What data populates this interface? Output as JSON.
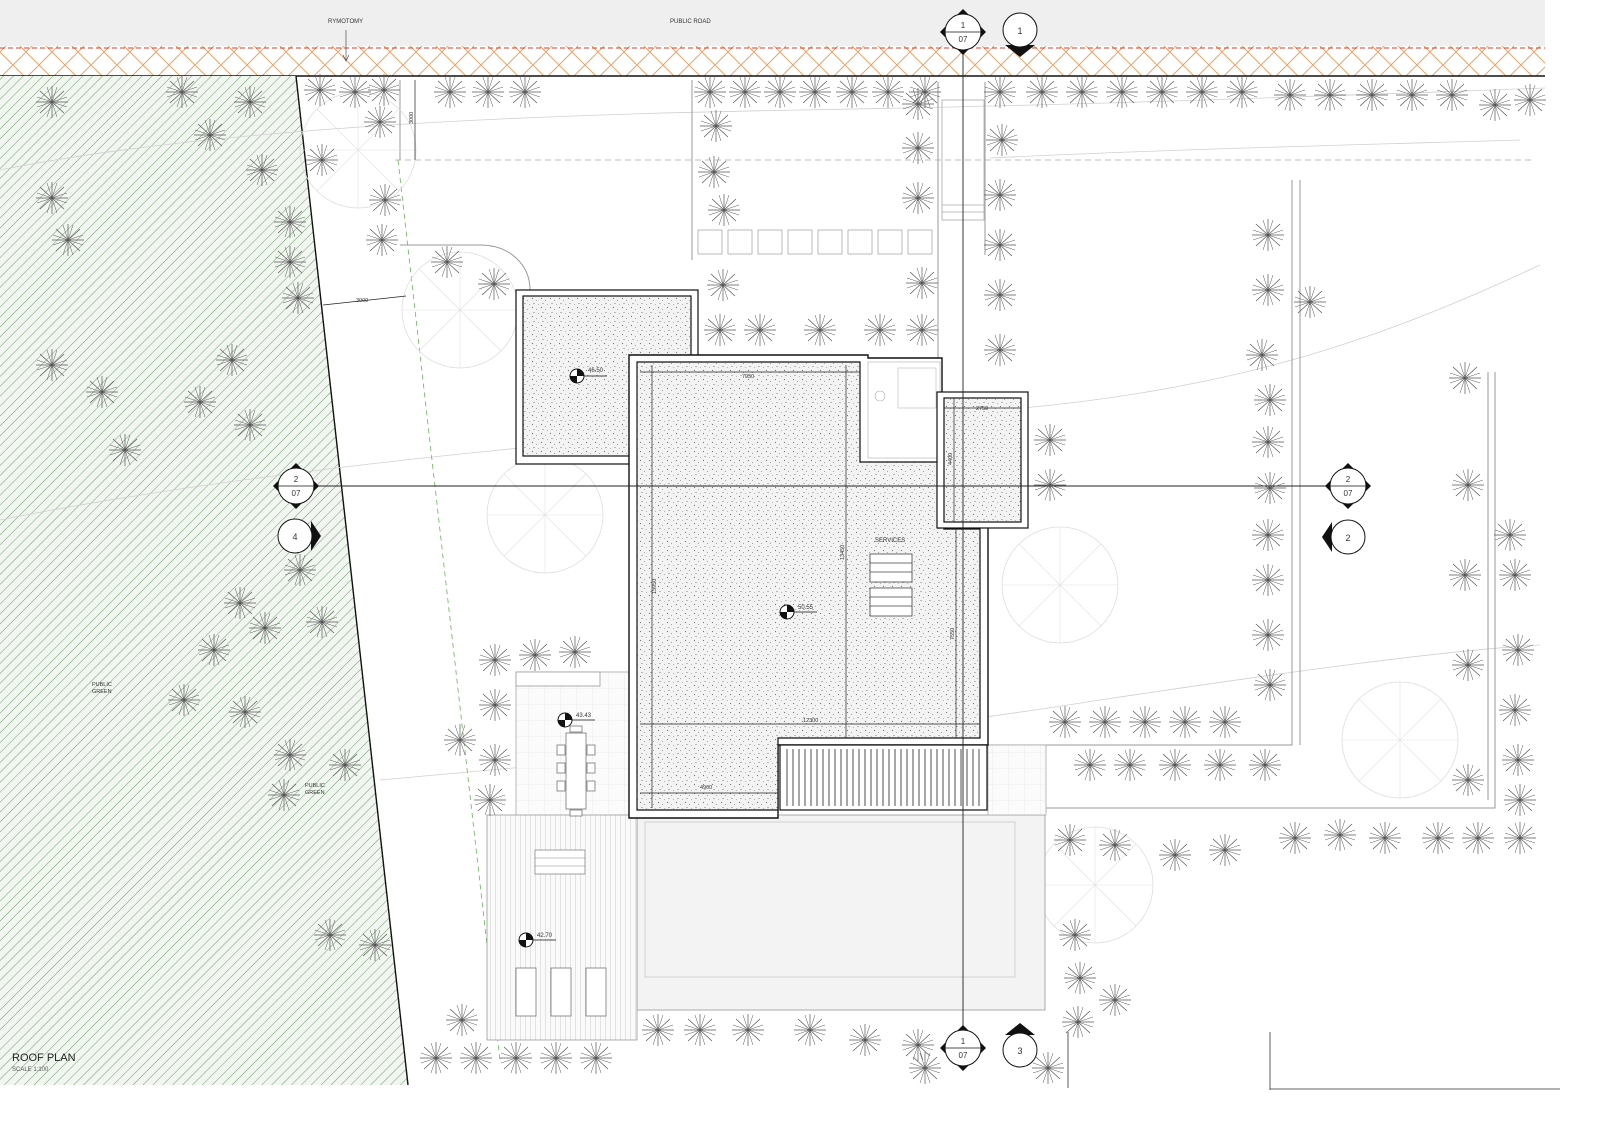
{
  "road": {
    "public_road": "PUBLIC ROAD",
    "rymotomy": "RYMOTOMY"
  },
  "zones": {
    "public_green_1": [
      "PUBLIC",
      "GREEN"
    ],
    "public_green_2": [
      "PUBLIC",
      "GREEN"
    ],
    "services": "SERVICES"
  },
  "levels": {
    "garage_roof": "46.50",
    "main_roof": "50.55",
    "terrace": "43.43",
    "deck": "42.70"
  },
  "dimensions": {
    "setback_road": "3000",
    "setback_side": "3000",
    "main_width": "7950",
    "main_depth": "13450",
    "main_total": "12300",
    "main_left": "4900",
    "main_height": "15950",
    "chimney_width": "2750",
    "chimney_depth": "4400",
    "services_depth": "7550"
  },
  "section_markers": [
    {
      "num": "1",
      "sheet": "07"
    },
    {
      "num": "2",
      "sheet": "07"
    },
    {
      "num": "2",
      "sheet": "07"
    },
    {
      "num": "1",
      "sheet": "07"
    }
  ],
  "elevation_markers": [
    "1",
    "2",
    "3",
    "4"
  ],
  "title": {
    "name": "ROOF PLAN",
    "scale": "SCALE 1:100"
  },
  "colors": {
    "green_hatch": "#6f9a6a",
    "road_hatch": "#e8a46a",
    "property_line": "#d23b2b",
    "road_fill": "#efefef"
  }
}
